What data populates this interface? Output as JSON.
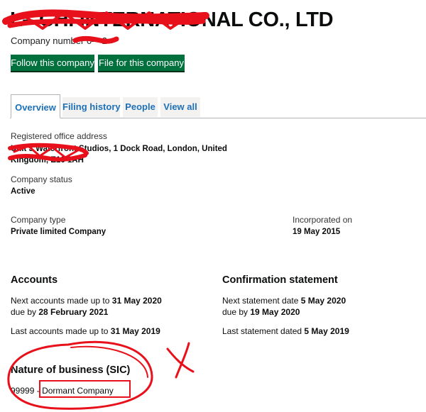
{
  "header": {
    "title": "L– CHI INTERNATIONAL CO., LTD",
    "company_number_label": "Company number",
    "company_number_value": "0––2"
  },
  "actions": {
    "follow": "Follow this company",
    "file": "File for this company"
  },
  "tabs": [
    {
      "label": "Overview",
      "active": true
    },
    {
      "label": "Filing history",
      "active": false
    },
    {
      "label": "People",
      "active": false
    },
    {
      "label": "View all",
      "active": false
    }
  ],
  "overview": {
    "registered_office": {
      "label": "Registered office address",
      "line1": "Unit 3 Waterfront Studios, 1 Dock Road, London, United",
      "line2": "Kingdom, E16 1AH"
    },
    "status": {
      "label": "Company status",
      "value": "Active"
    },
    "type": {
      "label": "Company type",
      "value": "Private limited Company"
    },
    "incorporated": {
      "label": "Incorporated on",
      "value": "19 May 2015"
    }
  },
  "accounts": {
    "heading": "Accounts",
    "next_prefix": "Next accounts made up to",
    "next_date": "31 May 2020",
    "due_prefix": "due by",
    "due_date": "28 February 2021",
    "last_prefix": "Last accounts made up to",
    "last_date": "31 May 2019"
  },
  "confirmation": {
    "heading": "Confirmation statement",
    "next_prefix": "Next statement date",
    "next_date": "5 May 2020",
    "due_prefix": "due by",
    "due_date": "19 May 2020",
    "last_prefix": "Last statement dated",
    "last_date": "5 May 2019"
  },
  "nature": {
    "heading": "Nature of business (SIC)",
    "code": "99999",
    "separator": "-",
    "description": "Dormant Company"
  },
  "annotation_colors": {
    "red": "#e8101a"
  }
}
